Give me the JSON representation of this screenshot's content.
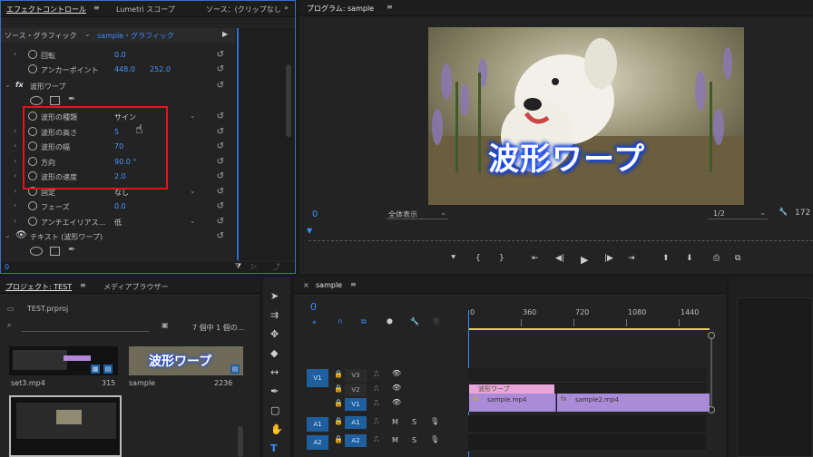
{
  "effects_panel": {
    "tab_effects": "エフェクトコントロール",
    "tab_lumetri": "Lumetri スコープ",
    "tab_source": "ソース：(クリップなし",
    "source_label": "ソース・グラフィック",
    "clip_label": "sample・グラフィック",
    "rows": [
      {
        "label": "回転",
        "value": "0.0"
      },
      {
        "label": "アンカーポイント",
        "value": "448.0",
        "value2": "252.0"
      }
    ],
    "fx_badge": "fx",
    "fx_name": "波形ワープ",
    "params": [
      {
        "label": "波形の種類",
        "value": "サイン"
      },
      {
        "label": "波形の高さ",
        "value": "5"
      },
      {
        "label": "波形の幅",
        "value": "70"
      },
      {
        "label": "方向",
        "value": "90.0 °"
      },
      {
        "label": "波形の速度",
        "value": "2.0"
      },
      {
        "label": "固定",
        "value": "なし"
      },
      {
        "label": "フェーズ",
        "value": "0.0"
      },
      {
        "label": "アンチエイリアス...",
        "value": "低"
      }
    ],
    "text_layer": "テキスト (波形ワープ)",
    "timecode": "0"
  },
  "program_panel": {
    "title": "プログラム: sample",
    "timecode": "0",
    "fit": "全体表示",
    "resolution": "1/2",
    "right_num": "172",
    "title_text": "波形ワープ"
  },
  "project_panel": {
    "tab_project": "プロジェクト: TEST",
    "tab_media": "メディアブラウザー",
    "file": "TEST.prproj",
    "search_placeholder": "",
    "count": "7 個中 1 個の...",
    "items": [
      {
        "name": "set3.mp4",
        "duration": "315"
      },
      {
        "name": "sample",
        "duration": "2236"
      }
    ],
    "thumb_title": "波形ワープ"
  },
  "timeline_panel": {
    "tab": "sample",
    "timecode": "0",
    "ruler": [
      "0",
      "360",
      "720",
      "1080",
      "1440"
    ],
    "video_tracks": [
      "V3",
      "V2",
      "V1"
    ],
    "audio_tracks": [
      "A1",
      "A2"
    ],
    "source_v": "V1",
    "source_a1": "A1",
    "source_a2": "A2",
    "m": "M",
    "s": "S",
    "clip_title": "波形ワープ",
    "clip1": "sample.mp4",
    "clip2": "sample2.mp4"
  },
  "colors": {
    "accent": "#3d8bff",
    "highlight_box": "#e0151c",
    "clip_purple": "#a98bd8",
    "clip_pink": "#e7a5d8"
  }
}
